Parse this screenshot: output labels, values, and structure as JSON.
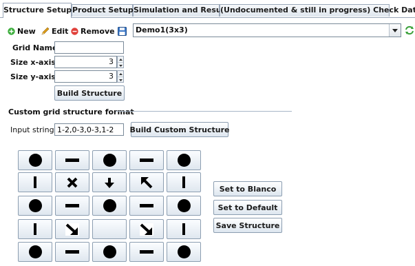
{
  "tabs": [
    {
      "label": "Structure Setup",
      "active": true
    },
    {
      "label": "Product Setup",
      "active": false
    },
    {
      "label": "Simulation and Results",
      "active": false
    },
    {
      "label": "(Undocumented & still in progress) Check Data",
      "active": false
    }
  ],
  "toolbar": {
    "new_label": "New",
    "edit_label": "Edit",
    "remove_label": "Remove",
    "selected_structure": "Demo1(3x3)"
  },
  "form": {
    "grid_name_label": "Grid Name :",
    "grid_name_value": "",
    "size_x_label": "Size x-axis :",
    "size_x_value": "3",
    "size_y_label": "Size y-axis :",
    "size_y_value": "3",
    "build_button": "Build Structure"
  },
  "custom": {
    "section_title": "Custom grid structure format",
    "input_label": "Input string:",
    "input_value": "1-2,0-3,0-3,1-2",
    "build_button": "Build Custom Structure"
  },
  "grid": {
    "rows": [
      [
        "dot-icon",
        "horizontal-bar-icon",
        "dot-icon",
        "horizontal-bar-icon",
        "dot-icon"
      ],
      [
        "vertical-bar-icon",
        "cross-icon",
        "arrow-down-icon",
        "arrow-up-left-icon",
        "vertical-bar-icon"
      ],
      [
        "dot-icon",
        "horizontal-bar-icon",
        "dot-icon",
        "horizontal-bar-icon",
        "dot-icon"
      ],
      [
        "vertical-bar-icon",
        "arrow-down-right-icon",
        "empty",
        "arrow-down-right-icon",
        "vertical-bar-icon"
      ],
      [
        "dot-icon",
        "horizontal-bar-icon",
        "dot-icon",
        "horizontal-bar-icon",
        "dot-icon"
      ]
    ]
  },
  "side_buttons": {
    "blanco": "Set to Blanco",
    "default": "Set to Default",
    "save": "Save Structure"
  },
  "colors": {
    "new_icon": "#3cae3c",
    "remove_icon": "#e0403a",
    "edit_icon": "#e3a21a",
    "save_icon": "#3b78c8",
    "refresh_icon": "#3aa13a"
  }
}
